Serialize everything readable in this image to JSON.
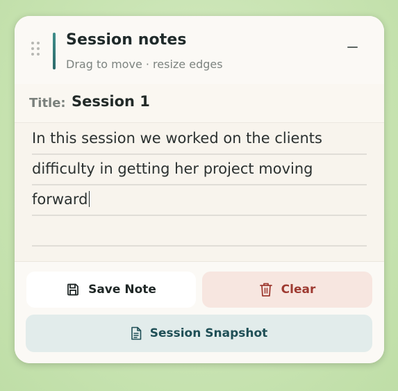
{
  "widget": {
    "title": "Session notes",
    "subtitle": "Drag to move · resize edges",
    "minimize_icon": "minus-icon",
    "drag_icon": "drag-handle-icon",
    "accent_color": "#2c6b6b"
  },
  "session": {
    "title_label": "Title:",
    "title_value": "Session 1"
  },
  "note": {
    "lines": [
      "In this session we worked on the clients",
      "difficulty in getting her project moving",
      "forward",
      ""
    ]
  },
  "actions": {
    "save_label": "Save Note",
    "save_icon": "floppy-disk-icon",
    "clear_label": "Clear",
    "clear_icon": "trash-icon",
    "clear_color": "#9e3a31",
    "snapshot_label": "Session Snapshot",
    "snapshot_icon": "document-icon"
  }
}
